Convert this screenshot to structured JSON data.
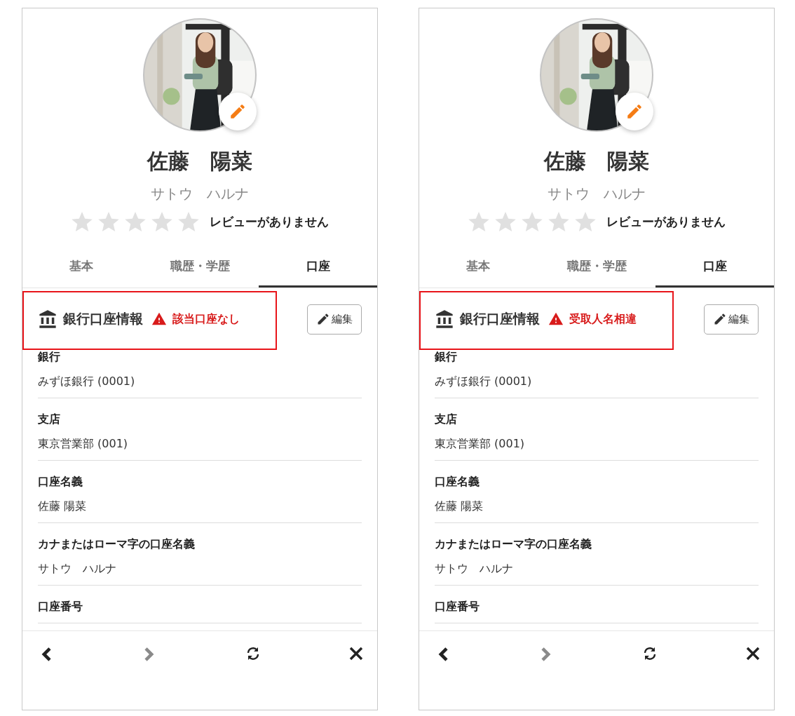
{
  "screens": [
    {
      "name": "佐藤　陽菜",
      "kana": "サトウ　ハルナ",
      "stars": 0,
      "review_text": "レビューがありません",
      "tabs": [
        {
          "label": "基本",
          "selected": false
        },
        {
          "label": "職歴・学歴",
          "selected": false
        },
        {
          "label": "口座",
          "selected": true
        }
      ],
      "section": {
        "title": "銀行口座情報",
        "warning": "該当口座なし",
        "highlighted": true,
        "edit_button": "編集"
      },
      "fields": [
        {
          "label": "銀行",
          "value": "みずほ銀行 (0001)"
        },
        {
          "label": "支店",
          "value": "東京営業部 (001)"
        },
        {
          "label": "口座名義",
          "value": "佐藤 陽菜"
        },
        {
          "label": "カナまたはローマ字の口座名義",
          "value": "サトウ　ハルナ"
        },
        {
          "label": "口座番号"
        }
      ],
      "nav": [
        {
          "kind": "back",
          "disabled": false
        },
        {
          "kind": "forward",
          "disabled": true
        },
        {
          "kind": "refresh",
          "disabled": false
        },
        {
          "kind": "close",
          "disabled": false
        }
      ]
    },
    {
      "name": "佐藤　陽菜",
      "kana": "サトウ　ハルナ",
      "stars": 0,
      "review_text": "レビューがありません",
      "tabs": [
        {
          "label": "基本",
          "selected": false
        },
        {
          "label": "職歴・学歴",
          "selected": false
        },
        {
          "label": "口座",
          "selected": true
        }
      ],
      "section": {
        "title": "銀行口座情報",
        "warning": "受取人名相違",
        "highlighted": true,
        "edit_button": "編集"
      },
      "fields": [
        {
          "label": "銀行",
          "value": "みずほ銀行 (0001)"
        },
        {
          "label": "支店",
          "value": "東京営業部 (001)"
        },
        {
          "label": "口座名義",
          "value": "佐藤 陽菜"
        },
        {
          "label": "カナまたはローマ字の口座名義",
          "value": "サトウ　ハルナ"
        },
        {
          "label": "口座番号"
        }
      ],
      "nav": [
        {
          "kind": "back",
          "disabled": false
        },
        {
          "kind": "forward",
          "disabled": true
        },
        {
          "kind": "refresh",
          "disabled": false
        },
        {
          "kind": "close",
          "disabled": false
        }
      ]
    }
  ]
}
